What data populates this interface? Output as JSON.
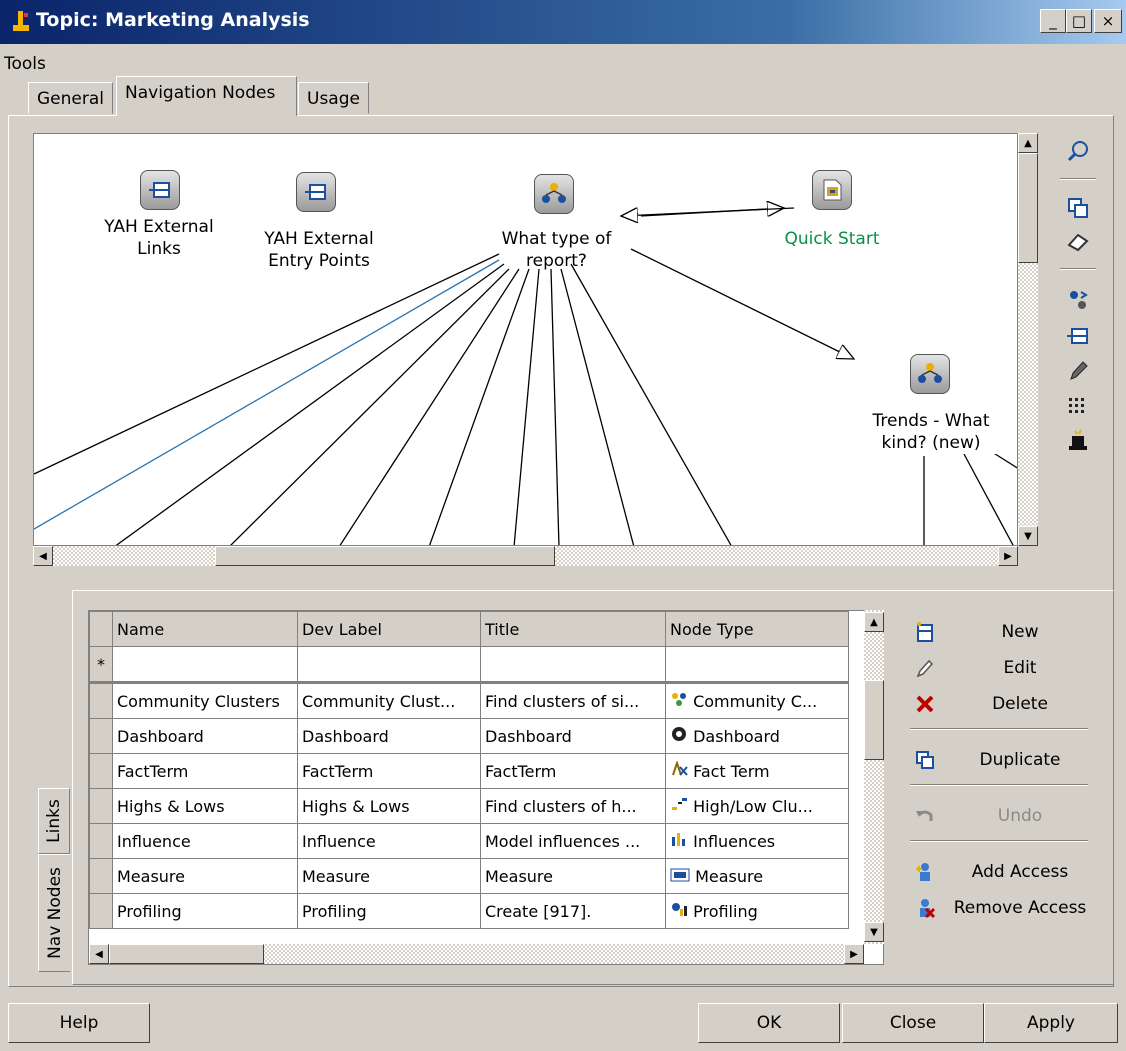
{
  "window": {
    "title": "Topic: Marketing Analysis",
    "minimize": "_",
    "maximize": "□",
    "close": "×"
  },
  "menu": {
    "tools": "Tools"
  },
  "tabs": [
    {
      "label": "General"
    },
    {
      "label": "Navigation Nodes",
      "active": true
    },
    {
      "label": "Usage"
    }
  ],
  "canvas": {
    "nodes": [
      {
        "label": "YAH External\nLinks",
        "icon": "external-link-icon"
      },
      {
        "label": "YAH External\nEntry Points",
        "icon": "external-link-icon"
      },
      {
        "label": "What type of\nreport?",
        "icon": "decision-icon"
      },
      {
        "label": "Quick Start",
        "icon": "document-icon",
        "color": "#0a8f4a"
      },
      {
        "label": "Trends - What\nkind? (new)",
        "icon": "decision-icon"
      }
    ]
  },
  "toolbar_icons": [
    "magnifier-icon",
    "copy-icon",
    "eraser-icon",
    "node-swap-icon",
    "external-link-icon",
    "pencil-icon",
    "grid-dots-icon",
    "magic-hat-icon"
  ],
  "grid": {
    "columns": [
      "Name",
      "Dev Label",
      "Title",
      "Node Type"
    ],
    "new_row_marker": "*",
    "rows": [
      {
        "name": "Community Clusters",
        "dev": "Community Clust...",
        "title": "Find clusters of si...",
        "type": "Community C...",
        "icon": "community-icon"
      },
      {
        "name": "Dashboard",
        "dev": "Dashboard",
        "title": "Dashboard",
        "type": "Dashboard",
        "icon": "dashboard-icon"
      },
      {
        "name": "FactTerm",
        "dev": "FactTerm",
        "title": "FactTerm",
        "type": "Fact Term",
        "icon": "fact-term-icon"
      },
      {
        "name": "Highs & Lows",
        "dev": "Highs & Lows",
        "title": "Find clusters of h...",
        "type": "High/Low Clu...",
        "icon": "highlow-icon"
      },
      {
        "name": "Influence",
        "dev": "Influence",
        "title": "Model influences ...",
        "type": "Influences",
        "icon": "influences-icon"
      },
      {
        "name": "Measure",
        "dev": "Measure",
        "title": "Measure",
        "type": "Measure",
        "icon": "measure-icon"
      },
      {
        "name": "Profiling",
        "dev": "Profiling",
        "title": "Create [917].",
        "type": "Profiling",
        "icon": "profiling-icon"
      }
    ]
  },
  "side_tabs": {
    "links": "Links",
    "nav_nodes": "Nav Nodes"
  },
  "actions": {
    "new": "New",
    "edit": "Edit",
    "delete": "Delete",
    "duplicate": "Duplicate",
    "undo": "Undo",
    "add_access": "Add Access",
    "remove_access": "Remove Access"
  },
  "buttons": {
    "help": "Help",
    "ok": "OK",
    "close": "Close",
    "apply": "Apply"
  }
}
